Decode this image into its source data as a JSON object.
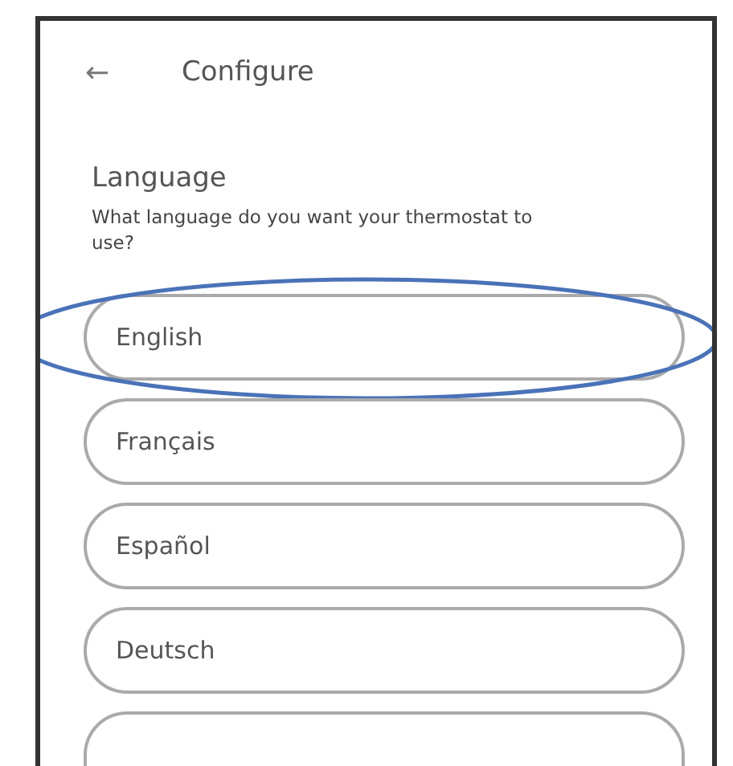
{
  "header": {
    "back_icon": "←",
    "title": "Configure"
  },
  "section": {
    "title": "Language",
    "question": "What language do you want your thermostat to use?"
  },
  "options": [
    {
      "label": "English",
      "circled": true
    },
    {
      "label": "Français",
      "circled": false
    },
    {
      "label": "Español",
      "circled": false
    },
    {
      "label": "Deutsch",
      "circled": false
    }
  ],
  "partial_option": {
    "kind": "cut-off"
  }
}
